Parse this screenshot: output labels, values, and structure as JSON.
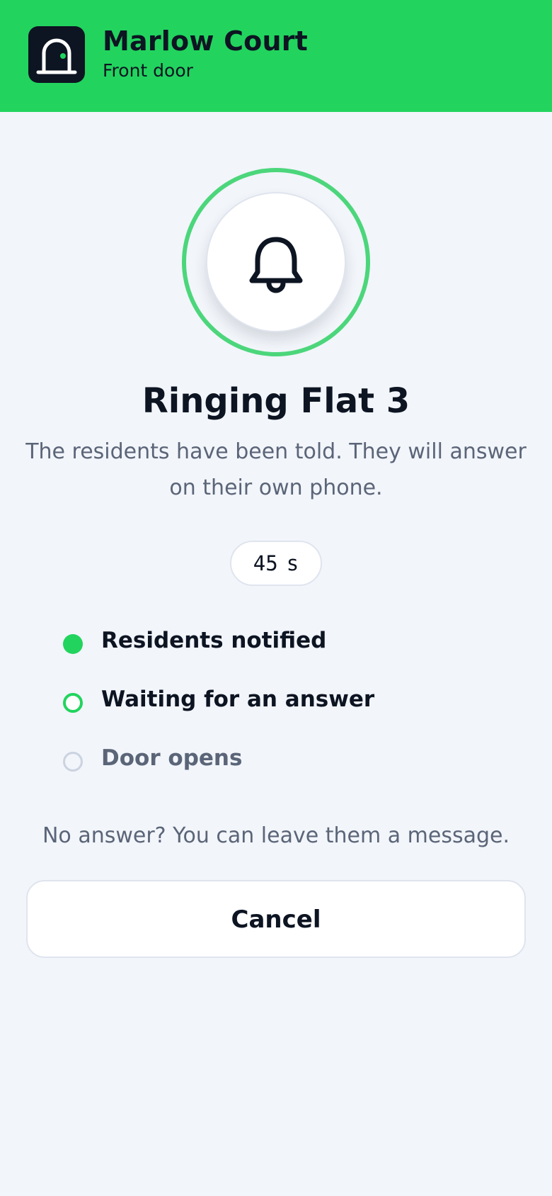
{
  "header": {
    "title": "Marlow Court",
    "subtitle": "Front door",
    "logo_icon": "door-icon",
    "background_color": "#22d45e"
  },
  "call": {
    "status_icon": "bell-icon",
    "title": "Ringing Flat 3",
    "description": "The residents have been told. They will answer on their own phone.",
    "timer_value": "45",
    "timer_unit": "s"
  },
  "steps": [
    {
      "label": "Residents notified",
      "state": "done"
    },
    {
      "label": "Waiting for an answer",
      "state": "active"
    },
    {
      "label": "Door opens",
      "state": "pending"
    }
  ],
  "hint": "No answer? You can leave them a message.",
  "cancel_label": "Cancel",
  "colors": {
    "accent": "#22d45e",
    "ring": "#4cd67b",
    "text_dark": "#0d1422",
    "text_muted": "#5b6578",
    "background": "#f2f5fa"
  }
}
